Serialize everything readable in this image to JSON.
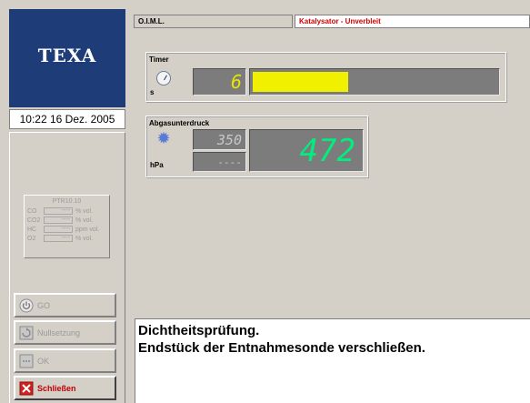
{
  "brand": {
    "logo": "TEXA",
    "color": "#1d3c78"
  },
  "clock": "10:22  16 Dez. 2005",
  "header": {
    "left_label": "O.I.M.L.",
    "right_label": "Katalysator - Unverbleit",
    "right_color": "#d00000"
  },
  "timer": {
    "title": "Timer",
    "unit": "s",
    "value": "6",
    "progress_fraction": 0.39,
    "bar_color": "#f0f000",
    "icon": "stopwatch-icon"
  },
  "abgas": {
    "title": "Abgasunterdruck",
    "unit": "hPa",
    "setpoint": "350",
    "secondary": "----",
    "value": "472",
    "value_color": "#00ee80",
    "icon": "gear-icon"
  },
  "analyzer": {
    "title": "PTR10.10",
    "rows": [
      {
        "label": "CO",
        "value": "----",
        "unit": "% vol."
      },
      {
        "label": "CO2",
        "value": "----",
        "unit": "% vol."
      },
      {
        "label": "HC",
        "value": "----",
        "unit": "ppm vol."
      },
      {
        "label": "O2",
        "value": "----",
        "unit": "% vol."
      }
    ]
  },
  "buttons": {
    "go": "GO",
    "zero": "Nullsetzung",
    "ok": "OK",
    "close": "Schließen"
  },
  "message": {
    "line1": "Dichtheitsprüfung.",
    "line2": "Endstück der Entnahmesonde verschließen."
  }
}
